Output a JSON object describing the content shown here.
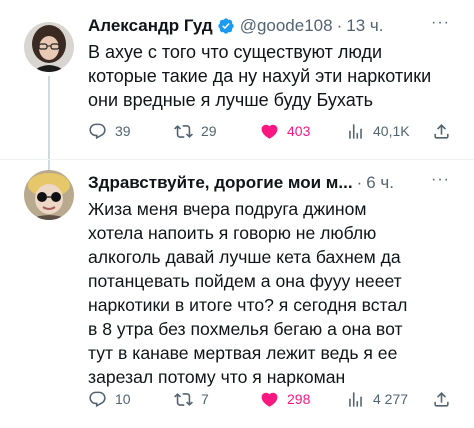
{
  "tweets": [
    {
      "name": "Александр Гуд",
      "verified": true,
      "handle": "@goode108",
      "separator": "·",
      "time": "13 ч.",
      "more": "···",
      "text": "В ахуе с того что существуют люди\nкоторые такие да ну нахуй эти наркотики\nони вредные я лучше буду Бухать",
      "stats": {
        "replies": "39",
        "retweets": "29",
        "likes": "403",
        "views": "40,1K"
      }
    },
    {
      "name": "Здравствуйте, дорогие мои м...",
      "verified": false,
      "handle": "",
      "separator": "·",
      "time": "6 ч.",
      "more": "···",
      "text": "Жиза меня вчера подруга джином\nхотела напоить я говорю не люблю\nалкоголь давай лучше кета бахнем да\nпотанцевать пойдем а она фууу нееет\nнаркотики в итоге что? я сегодня встал\nв 8 утра без похмелья бегаю а она вот\nтут в канаве мертвая лежит ведь я ее\nзарезал потому что я наркоман",
      "stats": {
        "replies": "10",
        "retweets": "7",
        "likes": "298",
        "views": "4 277"
      }
    }
  ],
  "colors": {
    "text": "#0f1419",
    "secondary": "#536471",
    "like": "#f91880",
    "verified": "#1d9bf0",
    "thread_line": "#cfd9de"
  }
}
